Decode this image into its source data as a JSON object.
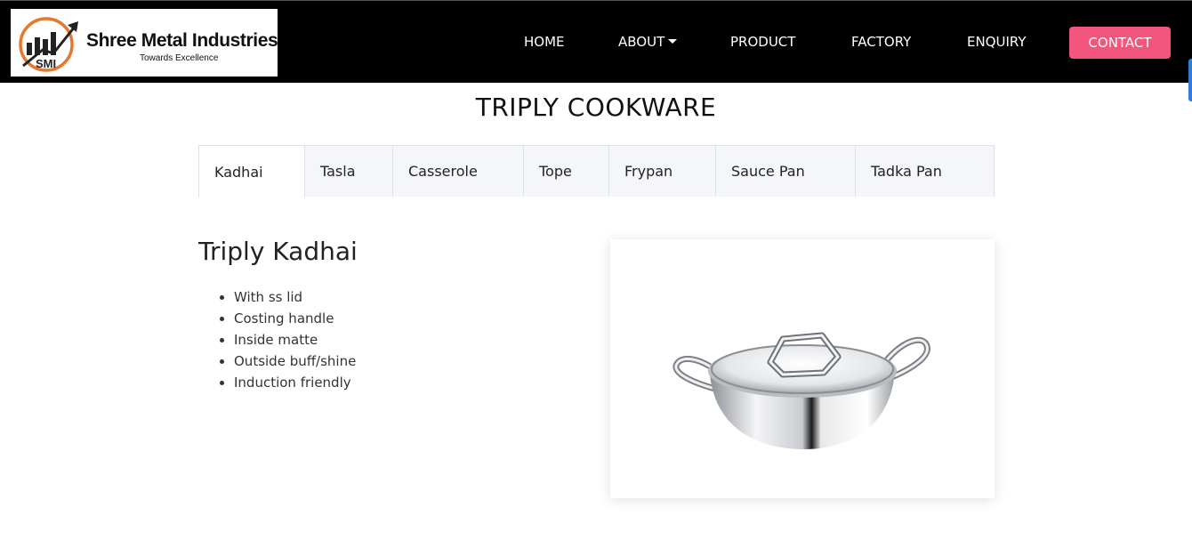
{
  "brand": {
    "name": "Shree Metal Industries",
    "tagline": "Towards Excellence",
    "logo_text": "SMI",
    "logo_icon": "rising-bars-arrow-icon"
  },
  "nav": {
    "home": "HOME",
    "about": "ABOUT",
    "product": "PRODUCT",
    "factory": "FACTORY",
    "enquiry": "ENQUIRY",
    "contact": "CONTACT"
  },
  "page": {
    "title": "TRIPLY COOKWARE"
  },
  "tabs": [
    {
      "label": "Kadhai",
      "active": true
    },
    {
      "label": "Tasla",
      "active": false
    },
    {
      "label": "Casserole",
      "active": false
    },
    {
      "label": "Tope",
      "active": false
    },
    {
      "label": "Frypan",
      "active": false
    },
    {
      "label": "Sauce Pan",
      "active": false
    },
    {
      "label": "Tadka Pan",
      "active": false
    }
  ],
  "product": {
    "title": "Triply Kadhai",
    "features": [
      "With ss lid",
      "Costing handle",
      "Inside matte",
      "Outside buff/shine",
      "Induction friendly"
    ],
    "image": "kadhai-with-lid-image"
  },
  "colors": {
    "header_bg": "#000000",
    "contact_button": "#f2557e",
    "logo_accent": "#e8772e",
    "tab_inactive_bg": "#f4f6f9"
  }
}
